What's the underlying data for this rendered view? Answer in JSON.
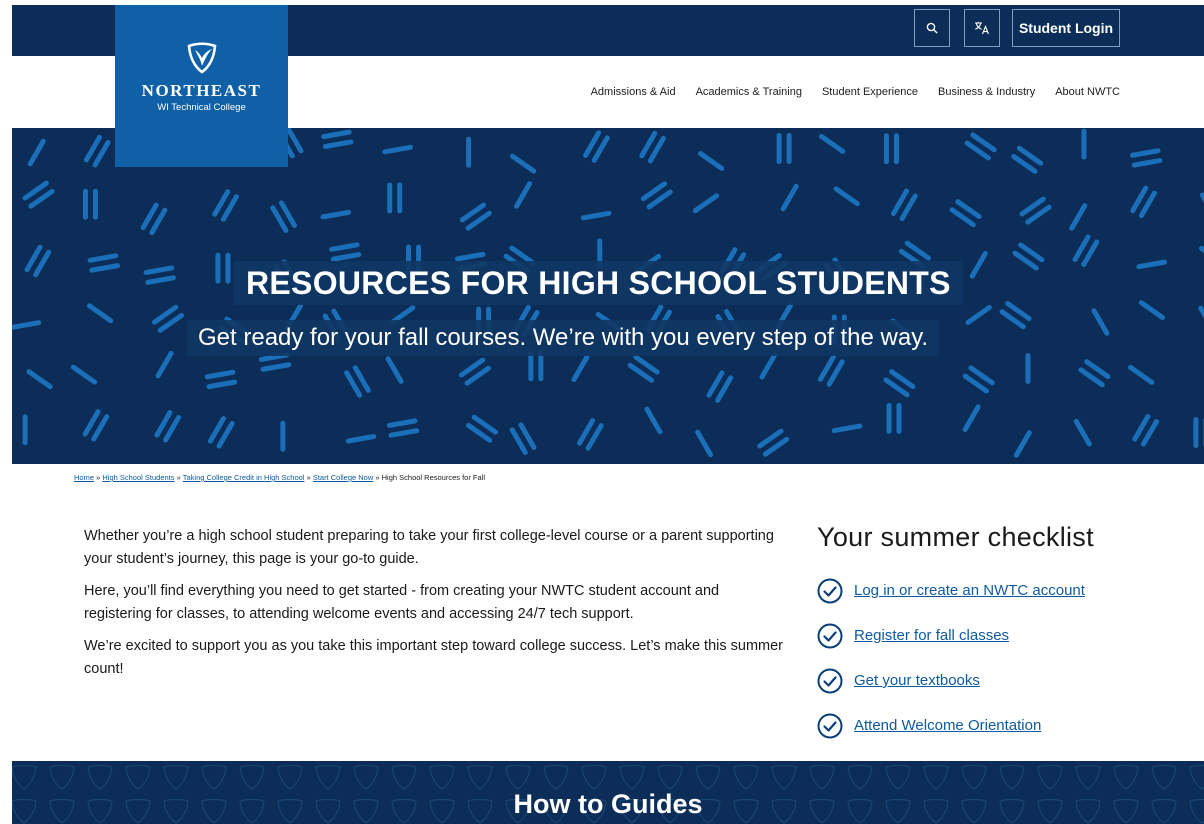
{
  "utility": {
    "search_icon": "search-icon",
    "translate_icon": "translate-icon",
    "login_label": "Student Login"
  },
  "logo": {
    "name": "NORTHEAST",
    "subtitle": "WI Technical College"
  },
  "nav": {
    "items": [
      {
        "label": "Admissions & Aid"
      },
      {
        "label": "Academics & Training"
      },
      {
        "label": "Student Experience"
      },
      {
        "label": "Business & Industry"
      },
      {
        "label": "About NWTC"
      }
    ]
  },
  "hero": {
    "title": "RESOURCES FOR HIGH SCHOOL STUDENTS",
    "subtitle": "Get ready for your fall courses. We’re with you every step of the way."
  },
  "breadcrumb": {
    "links": [
      {
        "label": "Home"
      },
      {
        "label": "High School Students"
      },
      {
        "label": "Taking College Credit in High School"
      },
      {
        "label": "Start College Now"
      }
    ],
    "separator": "»",
    "current": "High School Resources for Fall"
  },
  "intro": {
    "paragraphs": [
      "Whether you’re a high school student preparing to take your first college-level course or a parent supporting your student’s journey, this page is your go-to guide.",
      "Here, you’ll find everything you need to get started - from creating your NWTC student account and registering for classes, to attending welcome events and accessing 24/7 tech support.",
      "We’re excited to support you as you take this important step toward college success. Let’s make this summer count!"
    ]
  },
  "checklist": {
    "title": "Your summer checklist",
    "items": [
      {
        "label": "Log in or create an NWTC account"
      },
      {
        "label": "Register for fall classes"
      },
      {
        "label": "Get your textbooks"
      },
      {
        "label": "Attend Welcome Orientation"
      }
    ]
  },
  "guides": {
    "title": "How to Guides"
  },
  "colors": {
    "navy": "#0b2d57",
    "brand_blue": "#0f60a6",
    "pattern_blue": "#1b6fb8",
    "link": "#0f5aa0"
  }
}
